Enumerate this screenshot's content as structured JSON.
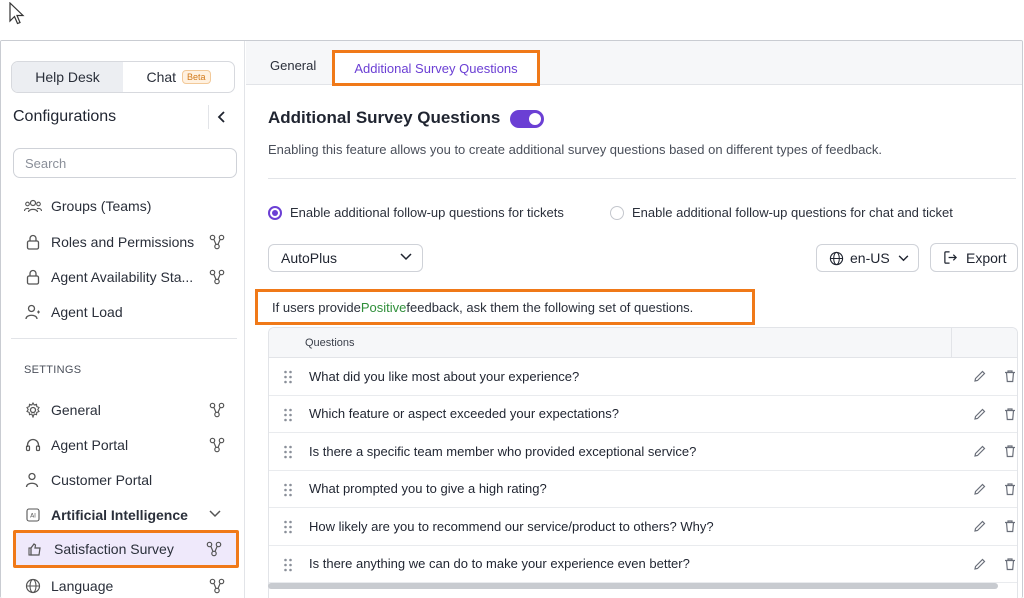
{
  "sidebar": {
    "segments": [
      {
        "label": "Help Desk"
      },
      {
        "label": "Chat",
        "badge": "Beta"
      }
    ],
    "title": "Configurations",
    "search_placeholder": "Search",
    "items": [
      {
        "label": "Groups (Teams)",
        "icon": "users-icon"
      },
      {
        "label": "Roles and Permissions",
        "icon": "lock-icon"
      },
      {
        "label": "Agent Availability Sta...",
        "icon": "lock-icon"
      },
      {
        "label": "Agent Load",
        "icon": "user-load-icon"
      }
    ],
    "settings_label": "SETTINGS",
    "settings_items": [
      {
        "label": "General",
        "icon": "gear-icon"
      },
      {
        "label": "Agent Portal",
        "icon": "headset-icon"
      },
      {
        "label": "Customer Portal",
        "icon": "user-icon"
      },
      {
        "label": "Artificial Intelligence",
        "icon": "ai-icon"
      },
      {
        "label": "Satisfaction Survey",
        "icon": "survey-icon"
      },
      {
        "label": "Language",
        "icon": "globe-icon"
      }
    ]
  },
  "main": {
    "tabs": [
      {
        "label": "General"
      },
      {
        "label": "Additional Survey Questions"
      }
    ],
    "heading": "Additional Survey Questions",
    "toggle_on": true,
    "description": "Enabling this feature allows you to create additional survey questions based on different types of feedback.",
    "radio_options": [
      {
        "label": "Enable additional follow-up questions for tickets",
        "selected": true
      },
      {
        "label": "Enable additional follow-up questions for chat and ticket",
        "selected": false
      }
    ],
    "product_select": "AutoPlus",
    "language_select": "en-US",
    "export_label": "Export",
    "callout": {
      "prefix": "If users provide ",
      "highlight": "Positive",
      "suffix": " feedback, ask them the following set of questions."
    },
    "table": {
      "header": "Questions",
      "rows": [
        "What did you like most about your experience?",
        "Which feature or aspect exceeded your expectations?",
        "Is there a specific team member who provided exceptional service?",
        "What prompted you to give a high rating?",
        "How likely are you to recommend our service/product to others? Why?",
        "Is there anything we can do to make your experience even better?"
      ]
    }
  },
  "colors": {
    "accent": "#6b3fd4",
    "highlight_border": "#f07918",
    "positive": "#2f8f3a"
  }
}
